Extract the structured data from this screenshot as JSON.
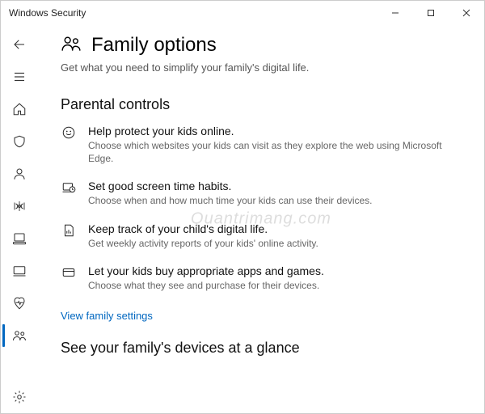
{
  "window": {
    "title": "Windows Security"
  },
  "page": {
    "title": "Family options",
    "subtitle": "Get what you need to simplify your family's digital life."
  },
  "section1_title": "Parental controls",
  "items": [
    {
      "title": "Help protect your kids online.",
      "desc": "Choose which websites your kids can visit as they explore the web using Microsoft Edge."
    },
    {
      "title": "Set good screen time habits.",
      "desc": "Choose when and how much time your kids can use their devices."
    },
    {
      "title": "Keep track of your child's digital life.",
      "desc": "Get weekly activity reports of your kids' online activity."
    },
    {
      "title": "Let your kids buy appropriate apps and games.",
      "desc": "Choose what they see and purchase for their devices."
    }
  ],
  "link_label": "View family settings",
  "section2_title": "See your family's devices at a glance",
  "watermark": "Quantrimang.com"
}
